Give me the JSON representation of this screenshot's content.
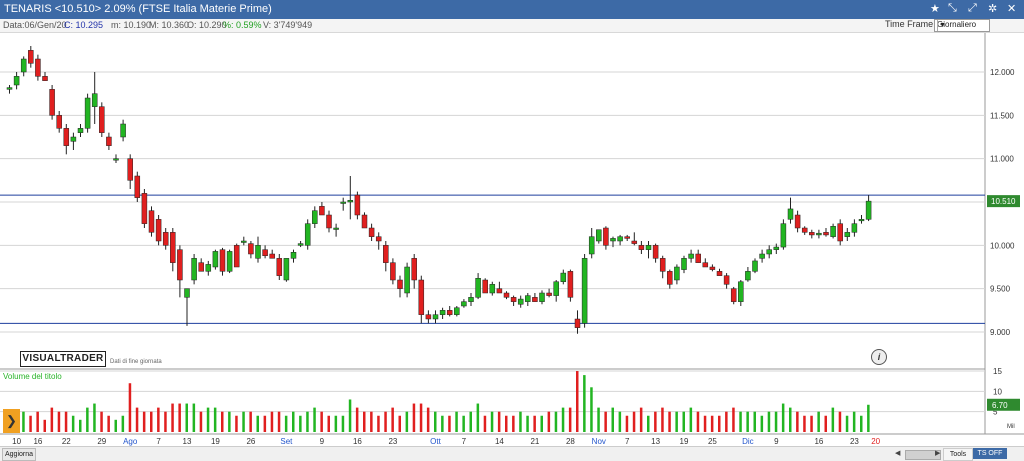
{
  "window": {
    "title": "TENARIS <10.510> 2.09% (FTSE Italia Materie Prime)",
    "icons": {
      "star": "★",
      "tools": "⤡",
      "pin": "⤢",
      "settings": "✲",
      "close": "✕"
    }
  },
  "infobar": {
    "date": "Data:06/Gen/20",
    "close": "C: 10.295",
    "min": "m: 10.190",
    "max": "M: 10.360",
    "open": "O: 10.290",
    "pct": "%: 0.59%",
    "volume": "V: 3'749'949"
  },
  "timeframe": {
    "label": "Time Frame",
    "value": "Giornaliero"
  },
  "logo": {
    "text": "VISUALTRADER",
    "sub": "Dati di fine giornata"
  },
  "volume_label": "Volume del titolo",
  "bottom": {
    "refresh": "Aggiorna",
    "tools": "Tools",
    "ts": "TS OFF",
    "mil": "Mil"
  },
  "colors": {
    "up": "#22b522",
    "down": "#e01f1f",
    "level": "#1d3f9e",
    "grid": "#d4d4d4"
  },
  "chart_data": {
    "type": "candlestick",
    "series_name": "TENARIS",
    "price_ticks": [
      "12.000",
      "11.500",
      "11.000",
      "10.500",
      "10.000",
      "9.500",
      "9.000"
    ],
    "price_tick_values": [
      12.0,
      11.5,
      11.0,
      10.5,
      10.0,
      9.5,
      9.0
    ],
    "ylim": [
      8.85,
      12.45
    ],
    "last_price": "10.510",
    "horizontal_lines": [
      10.58,
      9.1
    ],
    "volume_ticks": [
      "15",
      "10",
      "5"
    ],
    "volume_tick_values": [
      15,
      10,
      5
    ],
    "volume_ylim": [
      0,
      15.5
    ],
    "last_volume": "6.70",
    "x_labels": [
      {
        "i": 1,
        "text": "10",
        "month": false
      },
      {
        "i": 4,
        "text": "16",
        "month": false
      },
      {
        "i": 8,
        "text": "22",
        "month": false
      },
      {
        "i": 13,
        "text": "29",
        "month": false
      },
      {
        "i": 17,
        "text": "Ago",
        "month": true
      },
      {
        "i": 21,
        "text": "7",
        "month": false
      },
      {
        "i": 25,
        "text": "13",
        "month": false
      },
      {
        "i": 29,
        "text": "19",
        "month": false
      },
      {
        "i": 34,
        "text": "26",
        "month": false
      },
      {
        "i": 39,
        "text": "Set",
        "month": true
      },
      {
        "i": 44,
        "text": "9",
        "month": false
      },
      {
        "i": 49,
        "text": "16",
        "month": false
      },
      {
        "i": 54,
        "text": "23",
        "month": false
      },
      {
        "i": 60,
        "text": "Ott",
        "month": true
      },
      {
        "i": 64,
        "text": "7",
        "month": false
      },
      {
        "i": 69,
        "text": "14",
        "month": false
      },
      {
        "i": 74,
        "text": "21",
        "month": false
      },
      {
        "i": 79,
        "text": "28",
        "month": false
      },
      {
        "i": 83,
        "text": "Nov",
        "month": true
      },
      {
        "i": 87,
        "text": "7",
        "month": false
      },
      {
        "i": 91,
        "text": "13",
        "month": false
      },
      {
        "i": 95,
        "text": "19",
        "month": false
      },
      {
        "i": 99,
        "text": "25",
        "month": false
      },
      {
        "i": 104,
        "text": "Dic",
        "month": true
      },
      {
        "i": 108,
        "text": "9",
        "month": false
      },
      {
        "i": 114,
        "text": "16",
        "month": false
      },
      {
        "i": 119,
        "text": "23",
        "month": false
      },
      {
        "i": 122,
        "text": "20",
        "month": false,
        "highlight": true
      }
    ],
    "candles": [
      [
        11.8,
        11.85,
        11.75,
        11.82,
        3
      ],
      [
        11.85,
        12.0,
        11.8,
        11.95,
        4
      ],
      [
        12.0,
        12.18,
        11.95,
        12.15,
        5
      ],
      [
        12.25,
        12.3,
        12.05,
        12.1,
        4
      ],
      [
        12.15,
        12.2,
        11.9,
        11.95,
        5
      ],
      [
        11.95,
        12.0,
        11.9,
        11.9,
        3
      ],
      [
        11.8,
        11.85,
        11.45,
        11.5,
        6
      ],
      [
        11.5,
        11.55,
        11.3,
        11.35,
        5
      ],
      [
        11.35,
        11.4,
        11.05,
        11.15,
        5
      ],
      [
        11.2,
        11.3,
        11.1,
        11.25,
        4
      ],
      [
        11.3,
        11.4,
        11.25,
        11.35,
        3
      ],
      [
        11.35,
        11.75,
        11.3,
        11.7,
        6
      ],
      [
        11.6,
        12.0,
        11.4,
        11.75,
        7
      ],
      [
        11.6,
        11.65,
        11.25,
        11.3,
        5
      ],
      [
        11.25,
        11.3,
        11.1,
        11.15,
        4
      ],
      [
        11.0,
        11.05,
        10.95,
        11.0,
        3
      ],
      [
        11.25,
        11.45,
        11.2,
        11.4,
        4
      ],
      [
        11.0,
        11.05,
        10.65,
        10.75,
        12
      ],
      [
        10.8,
        10.85,
        10.5,
        10.55,
        6
      ],
      [
        10.6,
        10.65,
        10.2,
        10.25,
        5
      ],
      [
        10.4,
        10.45,
        10.1,
        10.15,
        5
      ],
      [
        10.3,
        10.35,
        10.0,
        10.05,
        6
      ],
      [
        10.15,
        10.2,
        9.95,
        10.0,
        5
      ],
      [
        10.15,
        10.2,
        9.7,
        9.8,
        7
      ],
      [
        9.95,
        10.0,
        9.4,
        9.6,
        7
      ],
      [
        9.4,
        9.5,
        9.07,
        9.5,
        7
      ],
      [
        9.6,
        9.9,
        9.55,
        9.85,
        7
      ],
      [
        9.8,
        9.85,
        9.7,
        9.7,
        5
      ],
      [
        9.7,
        9.82,
        9.65,
        9.78,
        6
      ],
      [
        9.75,
        9.95,
        9.72,
        9.93,
        6
      ],
      [
        9.95,
        9.97,
        9.65,
        9.7,
        5
      ],
      [
        9.7,
        9.95,
        9.68,
        9.93,
        5
      ],
      [
        10.0,
        10.02,
        9.75,
        9.75,
        4
      ],
      [
        10.05,
        10.1,
        10.0,
        10.05,
        5
      ],
      [
        10.02,
        10.05,
        9.85,
        9.9,
        5
      ],
      [
        9.85,
        10.1,
        9.8,
        10.0,
        4
      ],
      [
        9.95,
        10.0,
        9.85,
        9.88,
        4
      ],
      [
        9.9,
        9.95,
        9.85,
        9.85,
        5
      ],
      [
        9.85,
        9.9,
        9.6,
        9.65,
        5
      ],
      [
        9.6,
        9.85,
        9.58,
        9.85,
        4
      ],
      [
        9.85,
        9.95,
        9.8,
        9.92,
        5
      ],
      [
        10.0,
        10.05,
        9.98,
        10.02,
        4
      ],
      [
        10.0,
        10.3,
        9.95,
        10.25,
        5
      ],
      [
        10.25,
        10.45,
        10.2,
        10.4,
        6
      ],
      [
        10.45,
        10.5,
        10.35,
        10.35,
        5
      ],
      [
        10.35,
        10.4,
        10.15,
        10.2,
        4
      ],
      [
        10.2,
        10.25,
        10.1,
        10.2,
        4
      ],
      [
        10.5,
        10.55,
        10.4,
        10.5,
        4
      ],
      [
        10.5,
        10.8,
        10.3,
        10.52,
        8
      ],
      [
        10.58,
        10.62,
        10.3,
        10.35,
        6
      ],
      [
        10.35,
        10.38,
        10.2,
        10.2,
        5
      ],
      [
        10.2,
        10.25,
        10.05,
        10.1,
        5
      ],
      [
        10.1,
        10.15,
        9.95,
        10.05,
        4
      ],
      [
        10.0,
        10.05,
        9.7,
        9.8,
        5
      ],
      [
        9.8,
        9.85,
        9.55,
        9.6,
        6
      ],
      [
        9.6,
        9.65,
        9.4,
        9.5,
        4
      ],
      [
        9.45,
        9.8,
        9.4,
        9.75,
        5
      ],
      [
        9.85,
        9.9,
        9.5,
        9.6,
        7
      ],
      [
        9.6,
        9.65,
        9.1,
        9.2,
        7
      ],
      [
        9.2,
        9.25,
        9.1,
        9.15,
        6
      ],
      [
        9.15,
        9.25,
        9.1,
        9.2,
        5
      ],
      [
        9.2,
        9.28,
        9.15,
        9.25,
        4
      ],
      [
        9.25,
        9.3,
        9.18,
        9.2,
        4
      ],
      [
        9.2,
        9.3,
        9.18,
        9.28,
        5
      ],
      [
        9.3,
        9.38,
        9.28,
        9.35,
        4
      ],
      [
        9.35,
        9.45,
        9.3,
        9.4,
        5
      ],
      [
        9.4,
        9.68,
        9.38,
        9.62,
        7
      ],
      [
        9.6,
        9.62,
        9.45,
        9.45,
        4
      ],
      [
        9.45,
        9.58,
        9.42,
        9.55,
        5
      ],
      [
        9.5,
        9.58,
        9.45,
        9.45,
        5
      ],
      [
        9.45,
        9.47,
        9.38,
        9.4,
        4
      ],
      [
        9.4,
        9.42,
        9.3,
        9.35,
        4
      ],
      [
        9.32,
        9.42,
        9.28,
        9.38,
        5
      ],
      [
        9.35,
        9.45,
        9.3,
        9.42,
        4
      ],
      [
        9.4,
        9.45,
        9.35,
        9.35,
        4
      ],
      [
        9.35,
        9.48,
        9.32,
        9.45,
        4
      ],
      [
        9.45,
        9.5,
        9.4,
        9.42,
        5
      ],
      [
        9.42,
        9.6,
        9.35,
        9.58,
        5
      ],
      [
        9.58,
        9.72,
        9.55,
        9.68,
        6
      ],
      [
        9.7,
        9.72,
        9.35,
        9.4,
        6
      ],
      [
        9.15,
        9.25,
        8.98,
        9.05,
        15
      ],
      [
        9.1,
        9.9,
        9.05,
        9.85,
        14
      ],
      [
        9.9,
        10.2,
        9.85,
        10.1,
        11
      ],
      [
        10.05,
        10.18,
        10.02,
        10.18,
        6
      ],
      [
        10.2,
        10.22,
        9.95,
        10.0,
        5
      ],
      [
        10.05,
        10.1,
        9.98,
        10.08,
        6
      ],
      [
        10.05,
        10.12,
        10.0,
        10.1,
        5
      ],
      [
        10.1,
        10.12,
        10.05,
        10.08,
        4
      ],
      [
        10.05,
        10.15,
        10.0,
        10.02,
        5
      ],
      [
        10.0,
        10.05,
        9.9,
        9.95,
        6
      ],
      [
        9.95,
        10.05,
        9.85,
        10.0,
        4
      ],
      [
        10.0,
        10.02,
        9.8,
        9.85,
        5
      ],
      [
        9.85,
        9.88,
        9.62,
        9.7,
        6
      ],
      [
        9.7,
        9.72,
        9.5,
        9.55,
        5
      ],
      [
        9.6,
        9.78,
        9.55,
        9.75,
        5
      ],
      [
        9.72,
        9.88,
        9.68,
        9.85,
        5
      ],
      [
        9.85,
        9.95,
        9.8,
        9.9,
        6
      ],
      [
        9.9,
        9.95,
        9.8,
        9.8,
        5
      ],
      [
        9.8,
        9.85,
        9.75,
        9.75,
        4
      ],
      [
        9.75,
        9.78,
        9.7,
        9.72,
        4
      ],
      [
        9.7,
        9.73,
        9.65,
        9.65,
        4
      ],
      [
        9.65,
        9.68,
        9.5,
        9.55,
        5
      ],
      [
        9.5,
        9.52,
        9.32,
        9.35,
        6
      ],
      [
        9.35,
        9.6,
        9.3,
        9.58,
        5
      ],
      [
        9.6,
        9.75,
        9.58,
        9.7,
        5
      ],
      [
        9.7,
        9.85,
        9.68,
        9.82,
        5
      ],
      [
        9.85,
        9.95,
        9.8,
        9.9,
        4
      ],
      [
        9.9,
        10.0,
        9.85,
        9.95,
        5
      ],
      [
        9.95,
        10.02,
        9.9,
        9.98,
        5
      ],
      [
        9.98,
        10.3,
        9.95,
        10.25,
        7
      ],
      [
        10.3,
        10.55,
        10.25,
        10.42,
        6
      ],
      [
        10.35,
        10.4,
        10.15,
        10.2,
        5
      ],
      [
        10.2,
        10.22,
        10.12,
        10.15,
        4
      ],
      [
        10.15,
        10.18,
        10.08,
        10.12,
        4
      ],
      [
        10.12,
        10.18,
        10.08,
        10.14,
        5
      ],
      [
        10.15,
        10.2,
        10.1,
        10.12,
        4
      ],
      [
        10.1,
        10.25,
        10.08,
        10.22,
        6
      ],
      [
        10.25,
        10.3,
        10.0,
        10.05,
        5
      ],
      [
        10.1,
        10.2,
        10.05,
        10.15,
        4
      ],
      [
        10.15,
        10.3,
        10.1,
        10.25,
        5
      ],
      [
        10.3,
        10.35,
        10.25,
        10.3,
        4
      ],
      [
        10.3,
        10.58,
        10.28,
        10.51,
        6.7
      ]
    ]
  }
}
